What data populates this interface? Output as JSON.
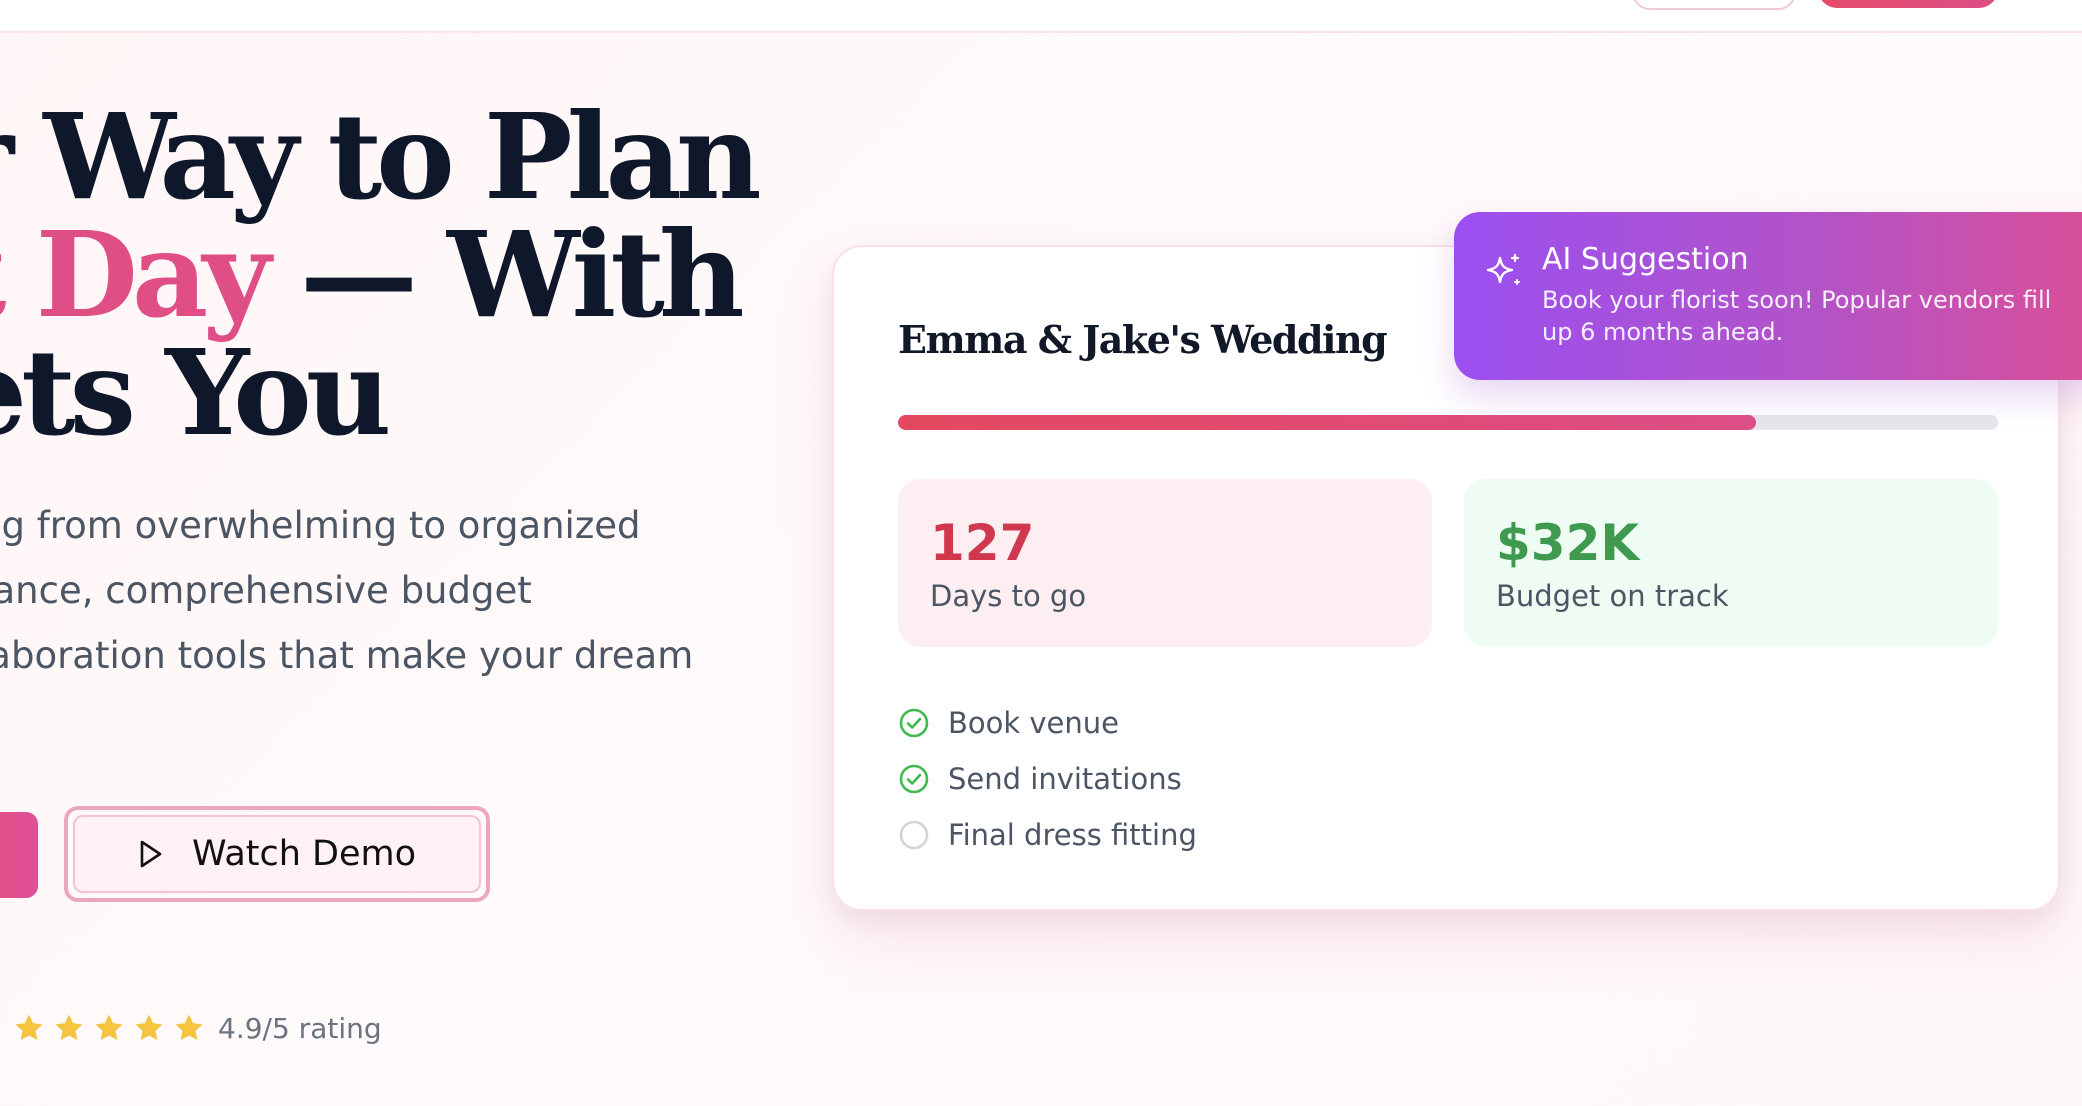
{
  "hero": {
    "headline_line1": "r Way to Plan",
    "headline_line2_accent": "t Day",
    "headline_line2_rest": " — With",
    "headline_line3": "ets You",
    "subtext_line1": "ng from overwhelming to organized",
    "subtext_line2": "tance, comprehensive budget",
    "subtext_line3": "laboration tools that make your dream",
    "watch_demo_label": "Watch Demo",
    "rating_value": 4.9,
    "rating_text": "4.9/5 rating"
  },
  "dashboard": {
    "title": "Emma & Jake's Wedding",
    "progress_fraction": 0.78,
    "days_value": "127",
    "days_label": "Days to go",
    "budget_value": "$32K",
    "budget_label": "Budget on track",
    "tasks": [
      {
        "label": "Book venue",
        "done": true
      },
      {
        "label": "Send invitations",
        "done": true
      },
      {
        "label": "Final dress fitting",
        "done": false
      }
    ]
  },
  "ai_suggestion": {
    "title": "AI Suggestion",
    "body": "Book your florist soon! Popular vendors fill up 6 months ahead."
  },
  "colors": {
    "accent_pink": "#df4f85",
    "days_red": "#d0384d",
    "budget_green": "#3f9a50",
    "check_green": "#3fb950",
    "star_gold": "#f5c542",
    "ai_purple": "#9b4ff0"
  },
  "icons": {
    "play": "play-icon",
    "star": "star-icon",
    "check": "check-circle-icon",
    "empty": "empty-circle-icon",
    "sparkle": "sparkle-icon"
  }
}
